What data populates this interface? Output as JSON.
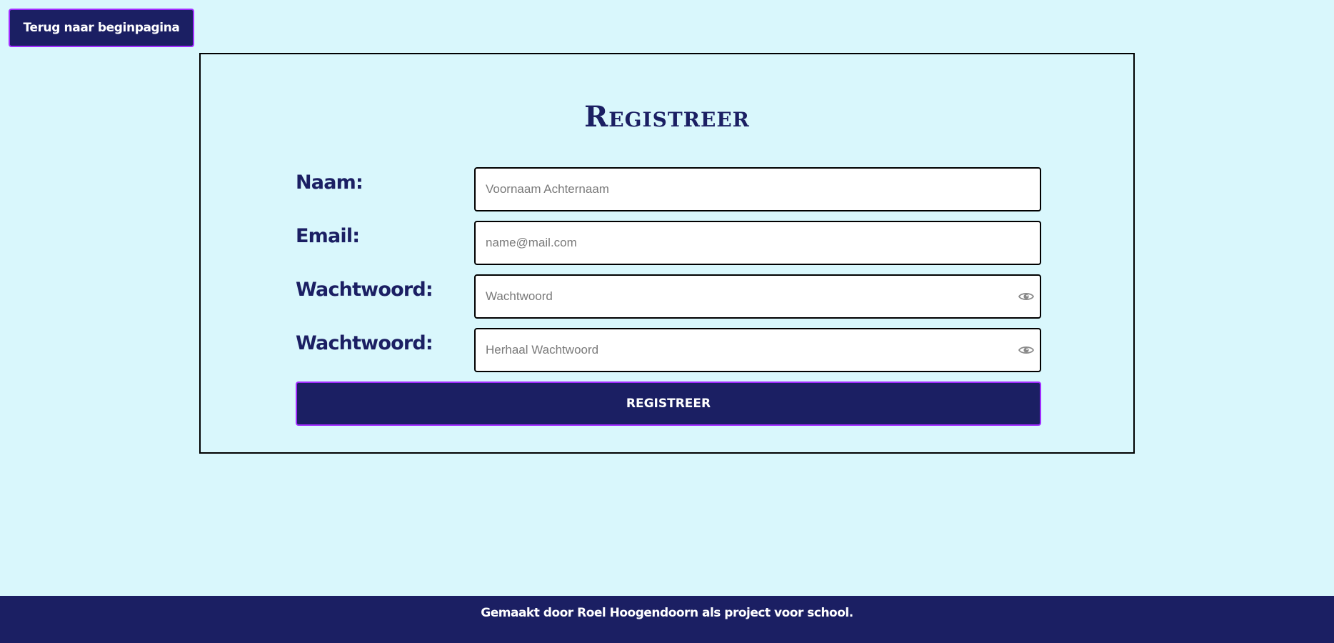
{
  "header": {
    "back_label": "Terug naar beginpagina"
  },
  "form": {
    "title": "Registreer",
    "fields": [
      {
        "label": "Naam:",
        "placeholder": "Voornaam Achternaam",
        "value": "",
        "type": "text"
      },
      {
        "label": "Email:",
        "placeholder": "name@mail.com",
        "value": "",
        "type": "email"
      },
      {
        "label": "Wachtwoord:",
        "placeholder": "Wachtwoord",
        "value": "",
        "type": "password",
        "toggle_icon": "eye-icon"
      },
      {
        "label": "Wachtwoord:",
        "placeholder": "Herhaal Wachtwoord",
        "value": "",
        "type": "password",
        "toggle_icon": "eye-icon"
      }
    ],
    "submit_label": "REGISTREER"
  },
  "footer": {
    "text": "Gemaakt door Roel Hoogendoorn als project voor school."
  },
  "colors": {
    "background": "#d9f7fc",
    "primary": "#1b1f63",
    "accent_border": "#a12cff",
    "icon_gray": "#8a8a8a"
  }
}
